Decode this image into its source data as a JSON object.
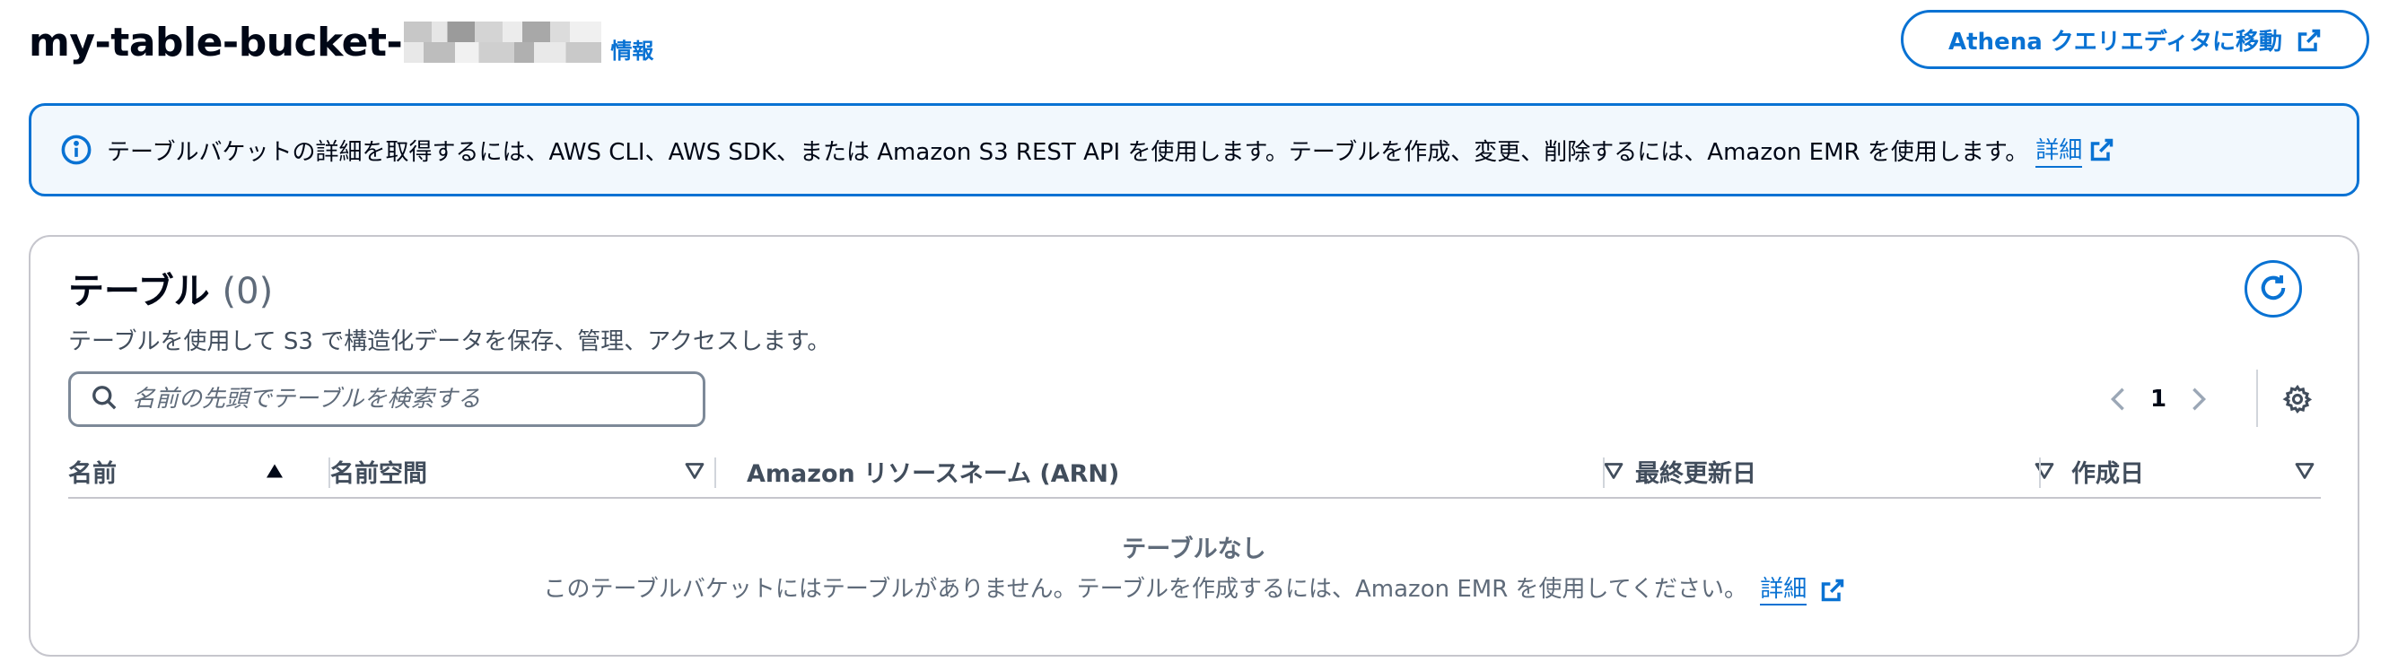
{
  "header": {
    "title_prefix": "my-table-bucket-",
    "info_link": "情報",
    "athena_button": "Athena クエリエディタに移動"
  },
  "alert": {
    "text": "テーブルバケットの詳細を取得するには、AWS CLI、AWS SDK、または Amazon S3 REST API を使用します。テーブルを作成、変更、削除するには、Amazon EMR を使用します。",
    "link": "詳細"
  },
  "table": {
    "title": "テーブル",
    "count": "(0)",
    "description": "テーブルを使用して S3 で構造化データを保存、管理、アクセスします。",
    "search_placeholder": "名前の先頭でテーブルを検索する",
    "page": "1",
    "columns": [
      {
        "label": "名前",
        "sort": "ascending"
      },
      {
        "label": "名前空間",
        "sort": "none"
      },
      {
        "label": "Amazon リソースネーム (ARN)",
        "sort": "none"
      },
      {
        "label": "最終更新日",
        "sort": "none"
      },
      {
        "label": "作成日",
        "sort": "none"
      }
    ],
    "empty_title": "テーブルなし",
    "empty_desc": "このテーブルバケットにはテーブルがありません。テーブルを作成するには、Amazon EMR を使用してください。",
    "empty_link": "詳細"
  },
  "icons": {
    "info": "info-circle-icon",
    "external": "external-link-icon",
    "refresh": "refresh-icon",
    "search": "search-icon",
    "prev": "chevron-left-icon",
    "next": "chevron-right-icon",
    "settings": "gear-icon",
    "sort_asc": "sort-ascending-icon",
    "sort_none": "sort-descending-outline-icon"
  },
  "colors": {
    "link": "#0972d3",
    "alert_bg": "#f2f8fd",
    "text_primary": "#000716",
    "text_secondary": "#5f6b7a"
  }
}
